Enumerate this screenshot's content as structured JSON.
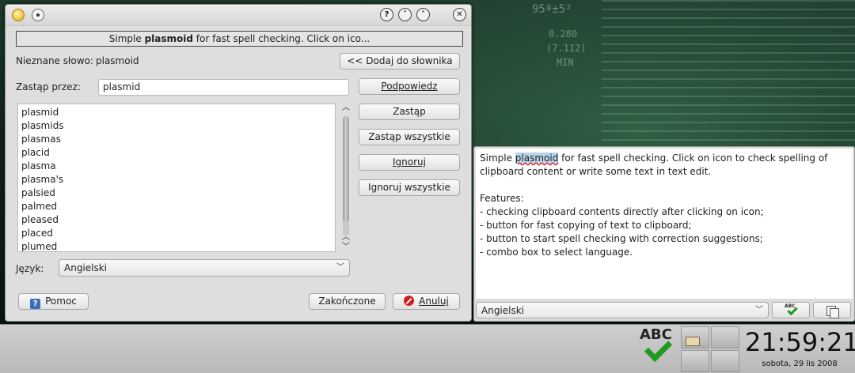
{
  "dialog": {
    "titlebar_buttons": {
      "help": "?",
      "minimize": "˅",
      "maximize": "˄",
      "close": "✕"
    },
    "hint_prefix": "Simple ",
    "hint_bold": "plasmoid",
    "hint_suffix": " for fast spell checking. Click on ico...",
    "unknown_word_label": "Nieznane słowo:",
    "unknown_word_value": "plasmoid",
    "add_to_dictionary_button": "<< Dodaj do słownika",
    "replace_with_label": "Zastąp przez:",
    "replace_with_value": "plasmid",
    "suggestions": [
      "plasmid",
      "plasmids",
      "plasmas",
      "placid",
      "plasma",
      "plasma's",
      "palsied",
      "palmed",
      "pleased",
      "placed",
      "plumed"
    ],
    "suggest_button": "Podpowiedz",
    "replace_button": "Zastąp",
    "replace_all_button": "Zastąp wszystkie",
    "ignore_button": "Ignoruj",
    "ignore_all_button": "Ignoruj wszystkie",
    "language_label": "Język:",
    "language_value": "Angielski",
    "help_button": "Pomoc",
    "finished_button": "Zakończone",
    "cancel_button": "Anuluj"
  },
  "plasmoid": {
    "text_prefix": "Simple ",
    "text_highlight": "plasmoid",
    "text_suffix": " for fast spell checking. Click on icon to check spelling of clipboard content or write some text in text edit.",
    "features_heading": "Features:",
    "features": [
      "- checking clipboard contents directly after clicking on icon;",
      "- button for fast copying of text to clipboard;",
      "- button to start spell checking with correction suggestions;",
      "- combo box to select language."
    ],
    "language_value": "Angielski",
    "check_button_label": "ABC"
  },
  "taskbar": {
    "tray_label": "ABC",
    "clock_time": "21:59:21",
    "clock_date": "sobota, 29 lis 2008"
  },
  "wallpaper": {
    "deco_1": "95ª±5²",
    "deco_2": "0.280",
    "deco_3": "(7.112)",
    "deco_4": "MIN"
  }
}
